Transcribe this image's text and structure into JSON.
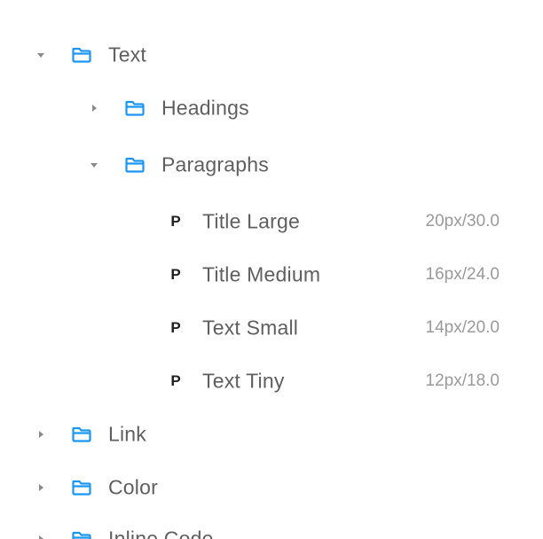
{
  "tree": {
    "text": {
      "label": "Text",
      "expanded": true
    },
    "headings": {
      "label": "Headings",
      "expanded": false
    },
    "paragraphs": {
      "label": "Paragraphs",
      "expanded": true
    },
    "styles": [
      {
        "tag": "P",
        "label": "Title Large",
        "meta": "20px/30.0"
      },
      {
        "tag": "P",
        "label": "Title Medium",
        "meta": "16px/24.0"
      },
      {
        "tag": "P",
        "label": "Text Small",
        "meta": "14px/20.0"
      },
      {
        "tag": "P",
        "label": "Text Tiny",
        "meta": "12px/18.0"
      }
    ],
    "link": {
      "label": "Link",
      "expanded": false
    },
    "color": {
      "label": "Color",
      "expanded": false
    },
    "inline_code": {
      "label": "Inline Code",
      "expanded": false
    }
  },
  "colors": {
    "folder_icon": "#1a96f0",
    "chevron": "#8a8a8a",
    "label": "#5f5f5f",
    "meta": "#9a9a9a"
  }
}
